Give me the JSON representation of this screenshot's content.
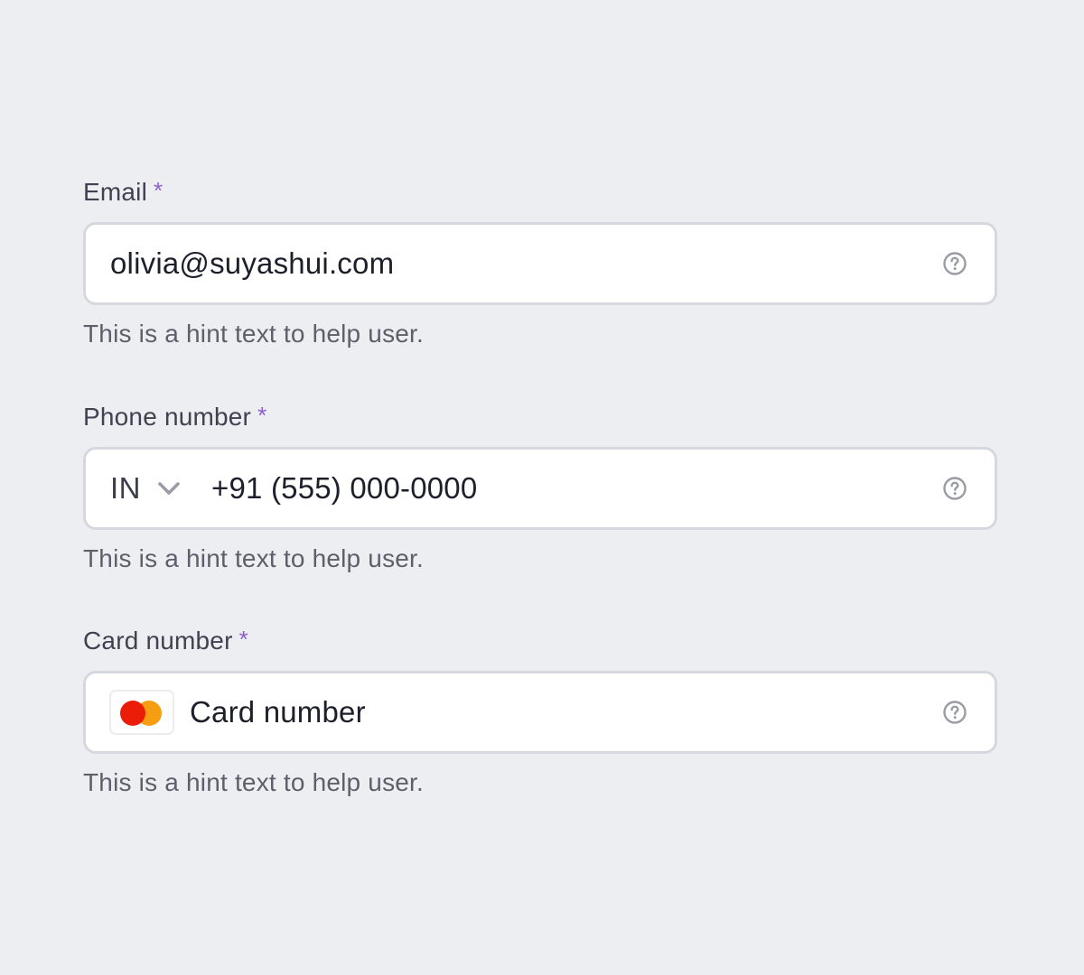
{
  "email": {
    "label": "Email",
    "required_mark": "*",
    "value": "olivia@suyashui.com",
    "hint": "This is a hint text to help user.",
    "help_icon": "question-circle-icon"
  },
  "phone": {
    "label": "Phone number",
    "required_mark": "*",
    "country_code": "IN",
    "dropdown_icon": "chevron-down-icon",
    "value": "+91 (555) 000-0000",
    "hint": "This is a hint text to help user.",
    "help_icon": "question-circle-icon"
  },
  "card": {
    "label": "Card number",
    "required_mark": "*",
    "brand_icon": "mastercard-icon",
    "placeholder": "Card number",
    "hint": "This is a hint text to help user.",
    "help_icon": "question-circle-icon"
  },
  "colors": {
    "background": "#edeef2",
    "required_accent": "#8b5fd0",
    "input_border": "#d6d8df",
    "mastercard_red": "#eb1c08",
    "mastercard_yellow": "#f59e12"
  }
}
